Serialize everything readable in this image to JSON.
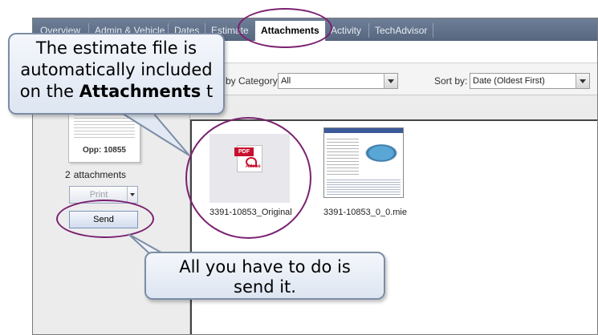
{
  "tabs": [
    {
      "label": "Overview",
      "active": false
    },
    {
      "label": "Admin & Vehicle",
      "active": false
    },
    {
      "label": "Dates",
      "active": false
    },
    {
      "label": "Estimate",
      "active": false
    },
    {
      "label": "Attachments",
      "active": true
    },
    {
      "label": "Activity",
      "active": false
    },
    {
      "label": "TechAdvisor",
      "active": false
    }
  ],
  "filters": {
    "category_label": "by Category:",
    "category_value": "All",
    "sort_label": "Sort by:",
    "sort_value": "Date (Oldest First)"
  },
  "left_panel": {
    "opp_label": "Opp: 10855",
    "attachment_count": "2",
    "attachment_word": "attachments",
    "print_label": "Print",
    "send_label": "Send"
  },
  "files": [
    {
      "name": "3391-10853_Original",
      "type": "pdf",
      "icon": "pdf-file-icon",
      "badge": "PDF",
      "brand": "Adobe"
    },
    {
      "name": "3391-10853_0_0.mie",
      "type": "mie",
      "icon": "estimate-thumbnail"
    }
  ],
  "callouts": {
    "top_line1": "The estimate file is",
    "top_line2": "automatically included",
    "top_line3_prefix": "on the ",
    "top_line3_bold": "Attachments",
    "top_line3_suffix": " t",
    "bottom_line1": "All you have to do is",
    "bottom_line2": "send it."
  },
  "colors": {
    "tabbar": "#56667f",
    "active_tab": "#ffffff",
    "highlight_ring": "#7a2171",
    "callout_border": "#7d8da6",
    "pdf_red": "#c8102e"
  }
}
